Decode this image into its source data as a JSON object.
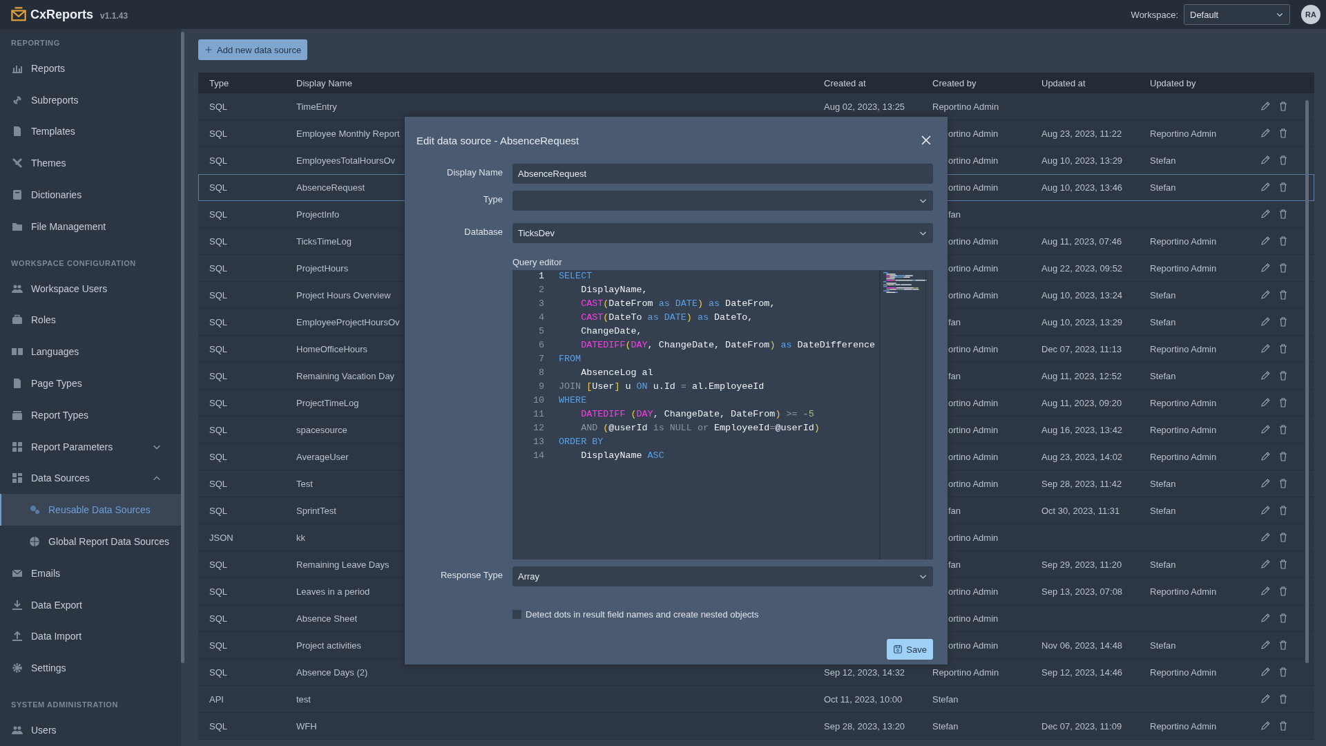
{
  "app": {
    "name": "CxReports",
    "version": "v1.1.43"
  },
  "workspace": {
    "label": "Workspace:",
    "value": "Default"
  },
  "user": {
    "initials": "RA"
  },
  "sidebar": {
    "sections": [
      {
        "title": "REPORTING",
        "items": [
          {
            "label": "Reports",
            "selected": false
          },
          {
            "label": "Subreports",
            "selected": false
          },
          {
            "label": "Templates",
            "selected": false
          },
          {
            "label": "Themes",
            "selected": false
          },
          {
            "label": "Dictionaries",
            "selected": false
          },
          {
            "label": "File Management",
            "selected": false
          }
        ]
      },
      {
        "title": "WORKSPACE CONFIGURATION",
        "items": [
          {
            "label": "Workspace Users",
            "selected": false
          },
          {
            "label": "Roles",
            "selected": false
          },
          {
            "label": "Languages",
            "selected": false
          },
          {
            "label": "Page Types",
            "selected": false
          },
          {
            "label": "Report Types",
            "selected": false
          },
          {
            "label": "Report Parameters",
            "selected": false,
            "expanded": false
          },
          {
            "label": "Data Sources",
            "selected": false,
            "expanded": true,
            "children": [
              {
                "label": "Reusable Data Sources",
                "selected": true
              },
              {
                "label": "Global Report Data Sources",
                "selected": false
              }
            ]
          },
          {
            "label": "Emails",
            "selected": false
          },
          {
            "label": "Data Export",
            "selected": false
          },
          {
            "label": "Data Import",
            "selected": false
          },
          {
            "label": "Settings",
            "selected": false
          }
        ]
      },
      {
        "title": "SYSTEM ADMINISTRATION",
        "items": [
          {
            "label": "Users",
            "selected": false
          }
        ]
      }
    ]
  },
  "toolbar": {
    "add_button": "Add new data source"
  },
  "table": {
    "columns": [
      "Type",
      "Display Name",
      "Created at",
      "Created by",
      "Updated at",
      "Updated by"
    ],
    "rows": [
      {
        "type": "SQL",
        "display_name": "TimeEntry",
        "created_at": "Aug 02, 2023, 13:25",
        "created_by": "Reportino Admin",
        "selected": false
      },
      {
        "type": "SQL",
        "display_name": "Employee Monthly Report",
        "created_by": "ortino Admin",
        "updated_at": "Aug 23, 2023, 11:22",
        "updated_by": "Reportino Admin",
        "selected": false
      },
      {
        "type": "SQL",
        "display_name": "EmployeesTotalHoursOv",
        "created_by": "ortino Admin",
        "updated_at": "Aug 10, 2023, 13:29",
        "updated_by": "Stefan",
        "selected": false
      },
      {
        "type": "SQL",
        "display_name": "AbsenceRequest",
        "created_by": "ortino Admin",
        "updated_at": "Aug 10, 2023, 13:46",
        "updated_by": "Stefan",
        "selected": true
      },
      {
        "type": "SQL",
        "display_name": "ProjectInfo",
        "created_by": "fan",
        "selected": false
      },
      {
        "type": "SQL",
        "display_name": "TicksTimeLog",
        "created_by": "ortino Admin",
        "updated_at": "Aug 11, 2023, 07:46",
        "updated_by": "Reportino Admin",
        "selected": false
      },
      {
        "type": "SQL",
        "display_name": "ProjectHours",
        "created_by": "ortino Admin",
        "updated_at": "Aug 22, 2023, 09:52",
        "updated_by": "Reportino Admin",
        "selected": false
      },
      {
        "type": "SQL",
        "display_name": "Project Hours Overview",
        "created_by": "ortino Admin",
        "updated_at": "Aug 10, 2023, 13:24",
        "updated_by": "Stefan",
        "selected": false
      },
      {
        "type": "SQL",
        "display_name": "EmployeeProjectHoursOv",
        "created_by": "fan",
        "updated_at": "Aug 10, 2023, 13:29",
        "updated_by": "Stefan",
        "selected": false
      },
      {
        "type": "SQL",
        "display_name": "HomeOfficeHours",
        "created_by": "ortino Admin",
        "updated_at": "Dec 07, 2023, 11:13",
        "updated_by": "Reportino Admin",
        "selected": false
      },
      {
        "type": "SQL",
        "display_name": "Remaining Vacation Day",
        "created_by": "fan",
        "updated_at": "Aug 11, 2023, 12:52",
        "updated_by": "Stefan",
        "selected": false
      },
      {
        "type": "SQL",
        "display_name": "ProjectTimeLog",
        "created_by": "ortino Admin",
        "updated_at": "Aug 11, 2023, 09:20",
        "updated_by": "Reportino Admin",
        "selected": false
      },
      {
        "type": "SQL",
        "display_name": "spacesource",
        "created_by": "ortino Admin",
        "updated_at": "Aug 16, 2023, 13:42",
        "updated_by": "Reportino Admin",
        "selected": false
      },
      {
        "type": "SQL",
        "display_name": "AverageUser",
        "created_by": "ortino Admin",
        "updated_at": "Aug 23, 2023, 14:02",
        "updated_by": "Reportino Admin",
        "selected": false
      },
      {
        "type": "SQL",
        "display_name": "Test",
        "created_by": "ortino Admin",
        "updated_at": "Sep 28, 2023, 11:42",
        "updated_by": "Stefan",
        "selected": false
      },
      {
        "type": "SQL",
        "display_name": "SprintTest",
        "created_by": "fan",
        "updated_at": "Oct 30, 2023, 11:31",
        "updated_by": "Stefan",
        "selected": false
      },
      {
        "type": "JSON",
        "display_name": "kk",
        "created_by": "ortino Admin",
        "selected": false
      },
      {
        "type": "SQL",
        "display_name": "Remaining Leave Days",
        "created_by": "fan",
        "updated_at": "Sep 29, 2023, 11:20",
        "updated_by": "Stefan",
        "selected": false
      },
      {
        "type": "SQL",
        "display_name": "Leaves in a period",
        "created_by": "ortino Admin",
        "updated_at": "Sep 13, 2023, 07:08",
        "updated_by": "Reportino Admin",
        "selected": false
      },
      {
        "type": "SQL",
        "display_name": "Absence Sheet",
        "created_by": "ortino Admin",
        "selected": false
      },
      {
        "type": "SQL",
        "display_name": "Project activities",
        "created_by": "ortino Admin",
        "updated_at": "Nov 06, 2023, 14:48",
        "updated_by": "Stefan",
        "selected": false
      },
      {
        "type": "SQL",
        "display_name": "Absence Days (2)",
        "created_at": "Sep 12, 2023, 14:32",
        "created_by": "Reportino Admin",
        "updated_at": "Sep 12, 2023, 14:46",
        "updated_by": "Reportino Admin",
        "selected": false
      },
      {
        "type": "API",
        "display_name": "test",
        "created_at": "Oct 11, 2023, 10:00",
        "created_by": "Stefan",
        "selected": false
      },
      {
        "type": "SQL",
        "display_name": "WFH",
        "created_at": "Sep 28, 2023, 13:20",
        "created_by": "Stefan",
        "updated_at": "Dec 07, 2023, 11:09",
        "updated_by": "Reportino Admin",
        "selected": false
      }
    ]
  },
  "dialog": {
    "title": "Edit data source - AbsenceRequest",
    "fields": [
      {
        "label": "Display Name",
        "kind": "input",
        "value": "AbsenceRequest"
      },
      {
        "label": "Type",
        "kind": "select"
      },
      {
        "label": "Database",
        "kind": "select",
        "value": "TicksDev"
      }
    ],
    "query_editor": {
      "label": "Query editor",
      "lines": [
        {
          "number": "1",
          "current": true,
          "indent": false,
          "tokens": [
            {
              "kind": "keyword",
              "text": "SELECT"
            }
          ]
        },
        {
          "number": "2",
          "current": false,
          "indent": true,
          "tokens": [
            {
              "kind": "identifier",
              "text": "DisplayName,"
            }
          ]
        },
        {
          "number": "3",
          "current": false,
          "indent": true,
          "tokens": [
            {
              "kind": "function",
              "text": "CAST"
            },
            {
              "kind": "bracket",
              "text": "("
            },
            {
              "kind": "identifier",
              "text": "DateFrom "
            },
            {
              "kind": "keyword",
              "text": "as DATE"
            },
            {
              "kind": "bracket",
              "text": ")"
            },
            {
              "kind": "keyword",
              "text": " as"
            },
            {
              "kind": "identifier",
              "text": " DateFrom,"
            }
          ]
        },
        {
          "number": "4",
          "current": false,
          "indent": true,
          "tokens": [
            {
              "kind": "function",
              "text": "CAST"
            },
            {
              "kind": "bracket",
              "text": "("
            },
            {
              "kind": "identifier",
              "text": "DateTo "
            },
            {
              "kind": "keyword",
              "text": "as DATE"
            },
            {
              "kind": "bracket",
              "text": ")"
            },
            {
              "kind": "keyword",
              "text": " as"
            },
            {
              "kind": "identifier",
              "text": " DateTo,"
            }
          ]
        },
        {
          "number": "5",
          "current": false,
          "indent": true,
          "tokens": [
            {
              "kind": "identifier",
              "text": "ChangeDate,"
            }
          ]
        },
        {
          "number": "6",
          "current": false,
          "indent": true,
          "tokens": [
            {
              "kind": "function",
              "text": "DATEDIFF"
            },
            {
              "kind": "bracket",
              "text": "("
            },
            {
              "kind": "function",
              "text": "DAY"
            },
            {
              "kind": "identifier",
              "text": ", ChangeDate, DateFrom"
            },
            {
              "kind": "bracket",
              "text": ")"
            },
            {
              "kind": "keyword",
              "text": " as"
            },
            {
              "kind": "identifier",
              "text": " DateDifference"
            }
          ]
        },
        {
          "number": "7",
          "current": false,
          "indent": false,
          "tokens": [
            {
              "kind": "keyword",
              "text": "FROM"
            }
          ]
        },
        {
          "number": "8",
          "current": false,
          "indent": true,
          "tokens": [
            {
              "kind": "identifier",
              "text": "AbsenceLog al"
            }
          ]
        },
        {
          "number": "9",
          "current": false,
          "indent": false,
          "tokens": [
            {
              "kind": "operator",
              "text": "JOIN "
            },
            {
              "kind": "bracket",
              "text": "["
            },
            {
              "kind": "identifier",
              "text": "User"
            },
            {
              "kind": "bracket",
              "text": "]"
            },
            {
              "kind": "identifier",
              "text": " u "
            },
            {
              "kind": "keyword",
              "text": "ON"
            },
            {
              "kind": "identifier",
              "text": " u.Id "
            },
            {
              "kind": "operator",
              "text": "="
            },
            {
              "kind": "identifier",
              "text": " al.EmployeeId"
            }
          ]
        },
        {
          "number": "10",
          "current": false,
          "indent": false,
          "tokens": [
            {
              "kind": "keyword",
              "text": "WHERE"
            }
          ]
        },
        {
          "number": "11",
          "current": false,
          "indent": true,
          "tokens": [
            {
              "kind": "function",
              "text": "DATEDIFF "
            },
            {
              "kind": "bracket",
              "text": "("
            },
            {
              "kind": "function",
              "text": "DAY"
            },
            {
              "kind": "identifier",
              "text": ", ChangeDate, DateFrom"
            },
            {
              "kind": "bracket",
              "text": ")"
            },
            {
              "kind": "operator",
              "text": " >="
            },
            {
              "kind": "number",
              "text": " -5"
            }
          ]
        },
        {
          "number": "12",
          "current": false,
          "indent": true,
          "tokens": [
            {
              "kind": "operator",
              "text": "AND "
            },
            {
              "kind": "bracket",
              "text": "("
            },
            {
              "kind": "identifier",
              "text": "@userId "
            },
            {
              "kind": "operator",
              "text": "is NULL or"
            },
            {
              "kind": "identifier",
              "text": " EmployeeId"
            },
            {
              "kind": "operator",
              "text": "="
            },
            {
              "kind": "identifier",
              "text": "@userId"
            },
            {
              "kind": "bracket",
              "text": ")"
            }
          ]
        },
        {
          "number": "13",
          "current": false,
          "indent": false,
          "tokens": [
            {
              "kind": "keyword",
              "text": "ORDER BY"
            }
          ]
        },
        {
          "number": "14",
          "current": false,
          "indent": true,
          "tokens": [
            {
              "kind": "identifier",
              "text": "DisplayName "
            },
            {
              "kind": "keyword",
              "text": "ASC"
            }
          ]
        }
      ]
    },
    "response_type": {
      "label": "Response Type",
      "value": "Array"
    },
    "nested_objects": {
      "label": "Detect dots in result field names and create nested objects",
      "checked": false
    },
    "save_button": "Save"
  }
}
